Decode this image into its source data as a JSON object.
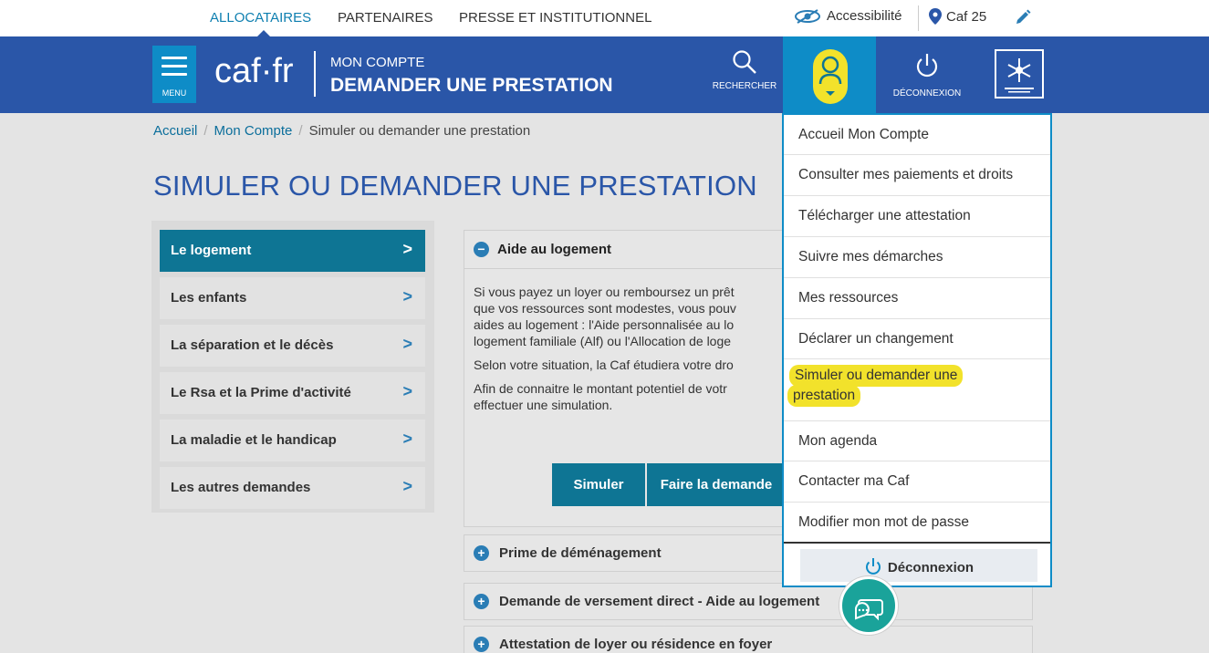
{
  "topnav": {
    "allocataires": "ALLOCATAIRES",
    "partenaires": "PARTENAIRES",
    "presse": "PRESSE ET INSTITUTIONNEL",
    "accessibilite": "Accessibilité",
    "caf_location": "Caf 25"
  },
  "header": {
    "menu_label": "MENU",
    "logo": "caf·fr",
    "subtitle": "MON COMPTE",
    "title": "DEMANDER UNE PRESTATION",
    "search_label": "RECHERCHER",
    "logout_label": "DÉCONNEXION",
    "caf_logo_text": "ALLOCATIONS FAMILIALES"
  },
  "breadcrumb": {
    "home": "Accueil",
    "account": "Mon Compte",
    "current": "Simuler ou demander une prestation",
    "separator": "/"
  },
  "page_title": "SIMULER OU DEMANDER UNE PRESTATION",
  "sidebar": {
    "items": [
      {
        "label": "Le logement"
      },
      {
        "label": "Les enfants"
      },
      {
        "label": "La séparation et le décès"
      },
      {
        "label": "Le Rsa et la Prime d'activité"
      },
      {
        "label": "La maladie et le handicap"
      },
      {
        "label": "Les autres demandes"
      }
    ],
    "chevron": ">"
  },
  "content": {
    "heading": "Aide au logement",
    "lines": [
      "Si vous payez un loyer ou remboursez un prêt",
      "que vos ressources sont modestes, vous pouv",
      "aides au logement : l'Aide personnalisée au lo",
      "logement familiale (Alf) ou l'Allocation de loge",
      "Selon votre situation, la Caf étudiera votre dro",
      "Afin de connaitre le montant potentiel de votr",
      "effectuer une simulation."
    ],
    "simulate_button": "Simuler",
    "apply_button": "Faire la demande"
  },
  "accordion": [
    {
      "label": "Prime de déménagement"
    },
    {
      "label": "Demande de versement direct - Aide au logement"
    },
    {
      "label": "Attestation de loyer ou résidence en foyer"
    }
  ],
  "dropdown": {
    "items": [
      {
        "label": "Accueil Mon Compte"
      },
      {
        "label": "Consulter mes paiements et droits"
      },
      {
        "label": "Télécharger une attestation"
      },
      {
        "label": "Suivre mes démarches"
      },
      {
        "label": "Mes ressources"
      },
      {
        "label": "Déclarer un changement"
      },
      {
        "label": "Mon agenda"
      },
      {
        "label": "Contacter ma Caf"
      },
      {
        "label": "Modifier mon mot de passe"
      }
    ],
    "highlighted_line1": "Simuler ou demander une",
    "highlighted_line2": "prestation",
    "logout": "Déconnexion"
  },
  "colors": {
    "header_blue": "#2a56a8",
    "accent_blue": "#0e8cc7",
    "sidebar_active": "#0e7594",
    "highlight_yellow": "#f2e22b",
    "chat_teal": "#1aa39a"
  }
}
